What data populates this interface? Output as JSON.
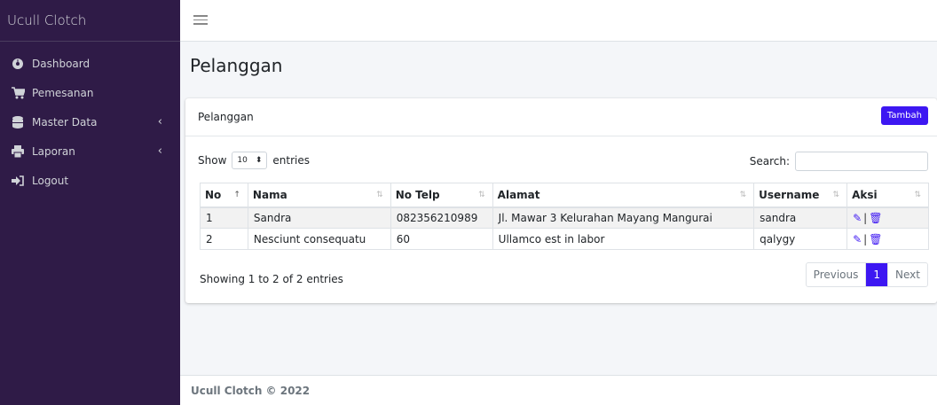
{
  "brand": "Ucull Clotch",
  "sidebar": {
    "items": [
      {
        "label": "Dashboard",
        "icon": "dashboard-icon"
      },
      {
        "label": "Pemesanan",
        "icon": "cart-icon"
      },
      {
        "label": "Master Data",
        "icon": "database-icon",
        "chevron": "‹"
      },
      {
        "label": "Laporan",
        "icon": "print-icon",
        "chevron": "‹"
      },
      {
        "label": "Logout",
        "icon": "logout-icon"
      }
    ]
  },
  "page": {
    "title": "Pelanggan"
  },
  "card": {
    "header": "Pelanggan",
    "add_label": "Tambah",
    "show_label": "Show",
    "entries_value": "10",
    "entries_label": "entries",
    "search_label": "Search:"
  },
  "table": {
    "headers": [
      "No",
      "Nama",
      "No Telp",
      "Alamat",
      "Username",
      "Aksi"
    ],
    "rows": [
      {
        "no": "1",
        "nama": "Sandra",
        "telp": "082356210989",
        "alamat": "Jl. Mawar 3 Kelurahan Mayang Mangurai",
        "username": "sandra"
      },
      {
        "no": "2",
        "nama": "Nesciunt consequatu",
        "telp": "60",
        "alamat": "Ullamco est in labor",
        "username": "qalygy"
      }
    ]
  },
  "pagination": {
    "info": "Showing 1 to 2 of 2 entries",
    "previous": "Previous",
    "current": "1",
    "next": "Next"
  },
  "footer": "Ucull Clotch © 2022",
  "colors": {
    "sidebar": "#2f1b47",
    "accent": "#3d17f2"
  }
}
